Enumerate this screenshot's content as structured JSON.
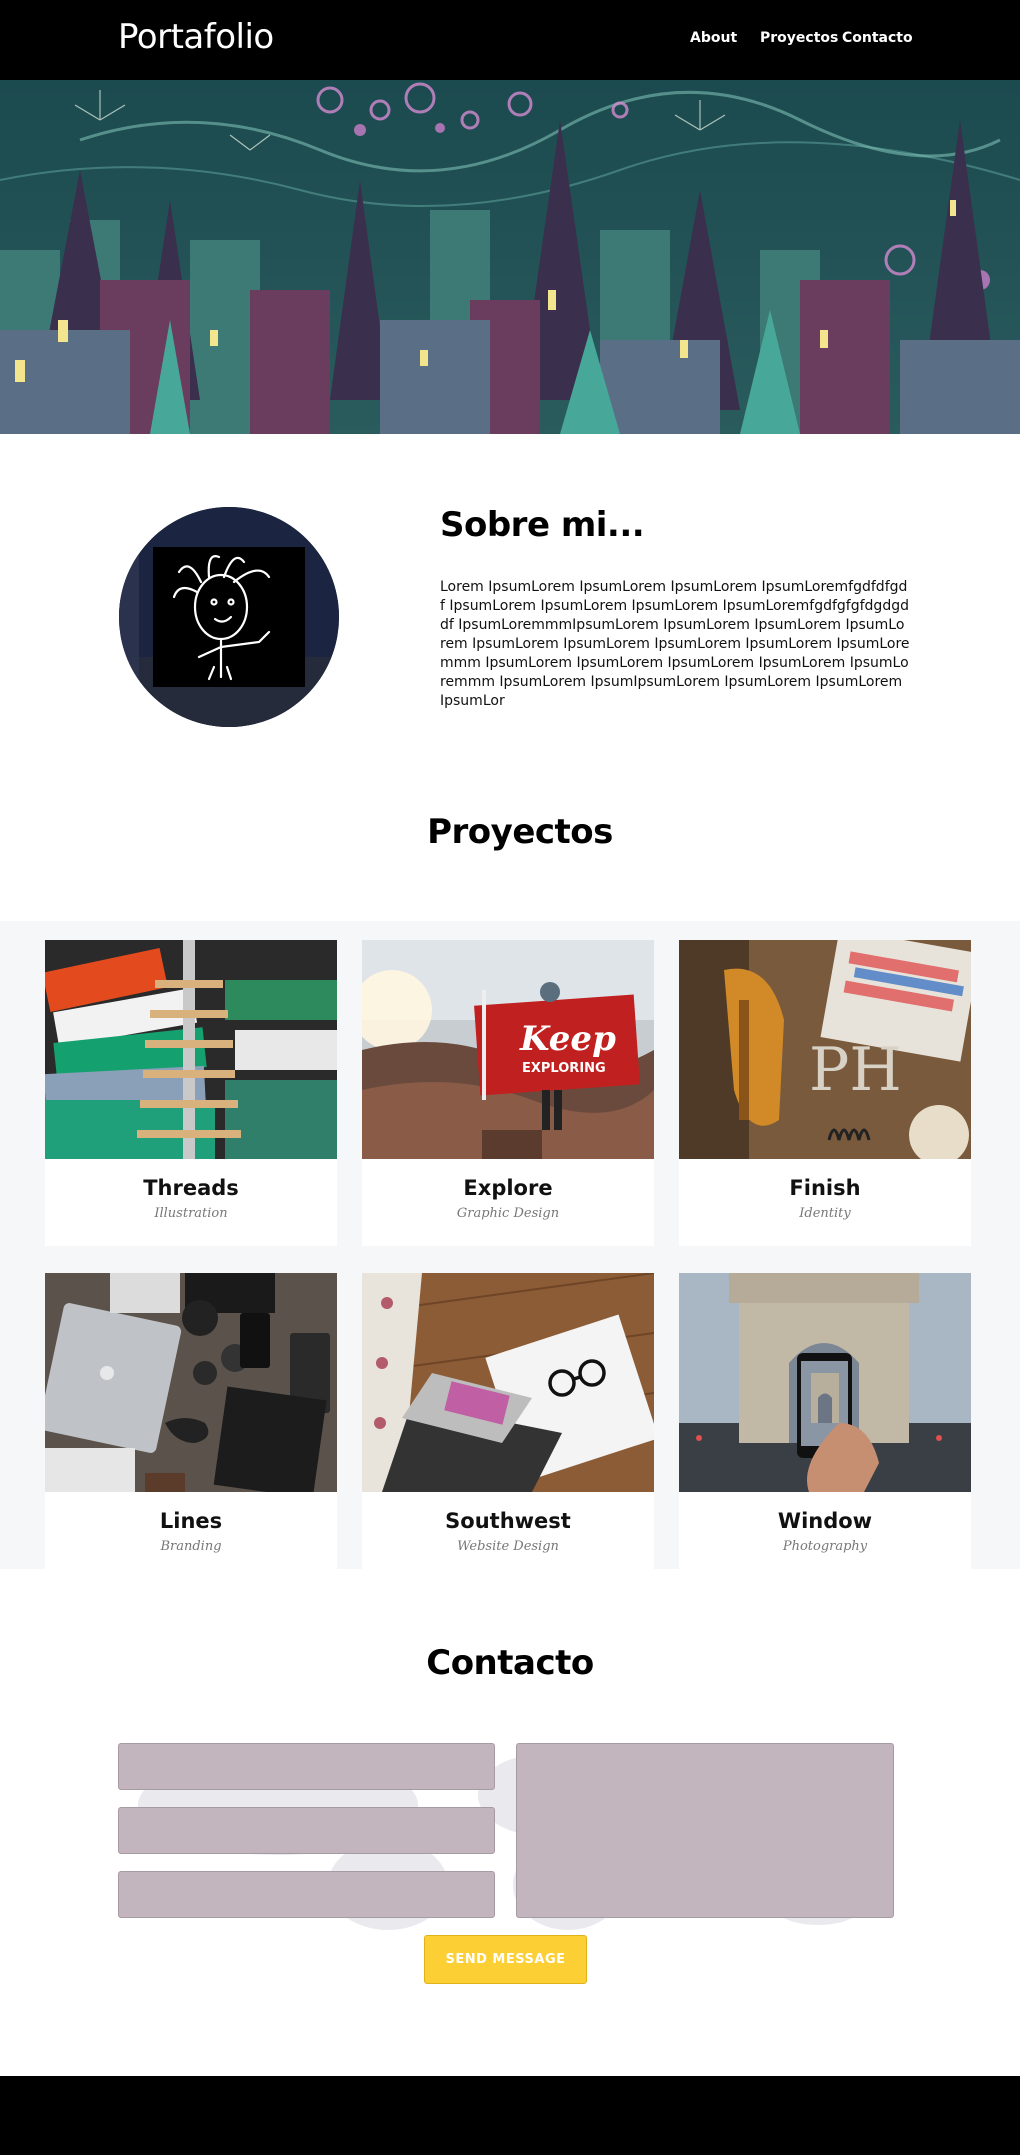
{
  "navbar": {
    "brand": "Portafolio",
    "links": [
      "About",
      "Proyectos",
      "Contacto"
    ]
  },
  "about": {
    "title": "Sobre mi...",
    "text": "Lorem IpsumLorem IpsumLorem IpsumLorem IpsumLoremfgdfdfgdf IpsumLorem IpsumLorem IpsumLorem IpsumLoremfgdfgfgfdgdgddf IpsumLoremmmIpsumLorem IpsumLorem IpsumLorem IpsumLorem IpsumLorem IpsumLorem IpsumLorem IpsumLorem IpsumLoremmm IpsumLorem IpsumLorem IpsumLorem IpsumLorem IpsumLoremmm IpsumLorem IpsumIpsumLorem IpsumLorem IpsumLorem IpsumLor"
  },
  "projects": {
    "title": "Proyectos",
    "items": [
      {
        "title": "Threads",
        "subtitle": "Illustration",
        "icon": "clothes-rack-photo"
      },
      {
        "title": "Explore",
        "subtitle": "Graphic Design",
        "icon": "keep-exploring-flag-photo"
      },
      {
        "title": "Finish",
        "subtitle": "Identity",
        "icon": "workbench-photo"
      },
      {
        "title": "Lines",
        "subtitle": "Branding",
        "icon": "desk-gadgets-photo"
      },
      {
        "title": "Southwest",
        "subtitle": "Website Design",
        "icon": "laptop-notebook-photo"
      },
      {
        "title": "Window",
        "subtitle": "Photography",
        "icon": "arc-de-triomphe-phone-photo"
      }
    ],
    "flag_text": {
      "line1": "Keep",
      "line2": "EXPLORING"
    }
  },
  "contact": {
    "title": "Contacto",
    "button_label": "SEND MESSAGE"
  },
  "colors": {
    "navbar": "#000000",
    "field_bg": "#c2b5be",
    "button": "#fcd034",
    "projects_bg": "#f6f7f9"
  }
}
